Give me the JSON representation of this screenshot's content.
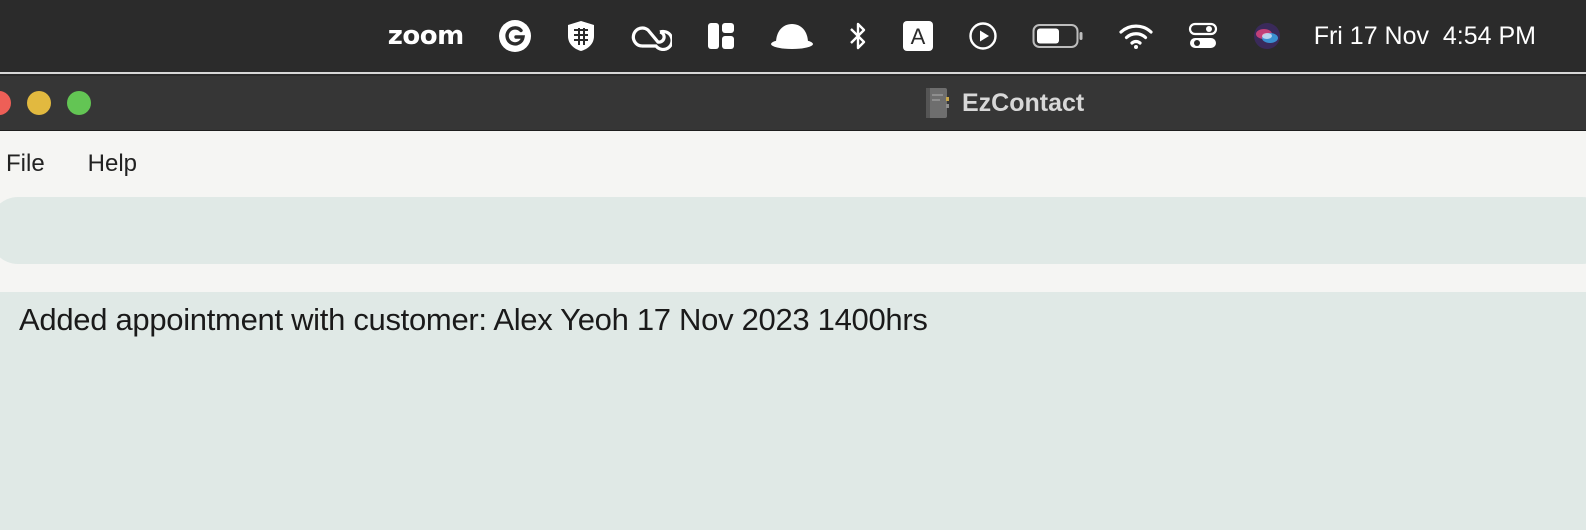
{
  "menubar": {
    "zoom_label": "zoom",
    "clock": "Fri 17 Nov  4:54 PM",
    "icons": [
      "zoom-logo",
      "grammarly-icon",
      "shield-icon",
      "creative-cloud-icon",
      "layout-icon",
      "helmet-icon",
      "bluetooth-icon",
      "input-source-icon",
      "play-circle-icon",
      "battery-icon",
      "wifi-icon",
      "control-center-icon",
      "siri-icon"
    ],
    "input_source_label": "A"
  },
  "window": {
    "title": "EzContact",
    "colors": {
      "close": "#ee5f57",
      "minimize": "#e2b93f",
      "maximize": "#63c554"
    }
  },
  "menu": {
    "file_label": "File",
    "help_label": "Help"
  },
  "command_box": {
    "value": "",
    "placeholder": ""
  },
  "result": {
    "message": "Added appointment with customer: Alex Yeoh 17 Nov 2023 1400hrs"
  },
  "theme": {
    "panel_bg": "#e0e9e6",
    "menu_bg": "#f5f5f3",
    "menubar_bg": "#2b2b2b"
  }
}
